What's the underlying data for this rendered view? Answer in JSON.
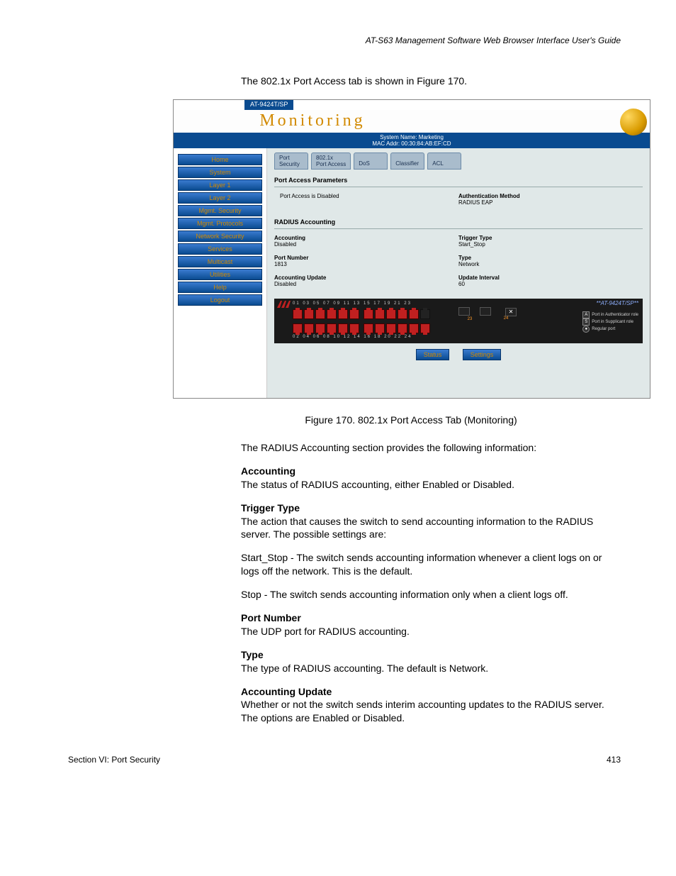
{
  "header": {
    "running_head": "AT-S63 Management Software Web Browser Interface User's Guide"
  },
  "intro_line": "The 802.1x Port Access tab is shown in Figure 170.",
  "screenshot": {
    "model": "AT-9424T/SP",
    "title": "Monitoring",
    "sys_name": "System Name: Marketing",
    "mac_addr": "MAC Addr: 00:30:84:AB:EF:CD",
    "nav": [
      "Home",
      "System",
      "Layer 1",
      "Layer 2",
      "Mgmt. Security",
      "Mgmt. Protocols",
      "Network Security",
      "Services",
      "Multicast",
      "Utilities",
      "Help",
      "Logout"
    ],
    "tabs": {
      "port_security_l1": "Port",
      "port_security_l2": "Security",
      "port_access_l1": "802.1x",
      "port_access_l2": "Port Access",
      "dos": "DoS",
      "classifier": "Classifier",
      "acl": "ACL"
    },
    "pap_title": "Port Access Parameters",
    "pap_status": "Port Access is Disabled",
    "auth_method_lbl": "Authentication Method",
    "auth_method_val": "RADIUS EAP",
    "ra_title": "RADIUS Accounting",
    "accounting_lbl": "Accounting",
    "accounting_val": "Disabled",
    "trigger_lbl": "Trigger Type",
    "trigger_val": "Start_Stop",
    "portnum_lbl": "Port Number",
    "portnum_val": "1813",
    "type_lbl": "Type",
    "type_val": "Network",
    "accupd_lbl": "Accounting Update",
    "accupd_val": "Disabled",
    "updint_lbl": "Update Interval",
    "updint_val": "60",
    "top_nums": "01  03  05  07  09  11      13  15  17  19  21  23",
    "bot_nums": "02  04  06  08  10  12      14  16  18  20  22  24",
    "extra_23": "23",
    "extra_24": "24",
    "panel_model": "**AT-9424T/SP**",
    "legend_a": "A",
    "legend_a_txt": "Port in Authenticator role",
    "legend_s": "S",
    "legend_s_txt": "Port in Supplicant role",
    "legend_reg": "Regular port",
    "btn_status": "Status",
    "btn_settings": "Settings"
  },
  "caption": "Figure 170. 802.1x Port Access Tab (Monitoring)",
  "radius_intro": "The RADIUS Accounting section provides the following information:",
  "defs": {
    "accounting_h": "Accounting",
    "accounting_t": "The status of RADIUS accounting, either Enabled or Disabled.",
    "trigger_h": "Trigger Type",
    "trigger_t": "The action that causes the switch to send accounting information to the RADIUS server. The possible settings are:",
    "trigger_start": "Start_Stop - The switch sends accounting information whenever a client logs on or logs off the network. This is the default.",
    "trigger_stop": "Stop - The switch sends accounting information only when a client logs off.",
    "portnum_h": "Port Number",
    "portnum_t": "The UDP port for RADIUS accounting.",
    "type_h": "Type",
    "type_t": "The type of RADIUS accounting. The default is Network.",
    "accupd_h": "Accounting Update",
    "accupd_t": "Whether or not the switch sends interim accounting updates to the RADIUS server. The options are Enabled or Disabled."
  },
  "footer": {
    "section": "Section VI: Port Security",
    "page": "413"
  }
}
